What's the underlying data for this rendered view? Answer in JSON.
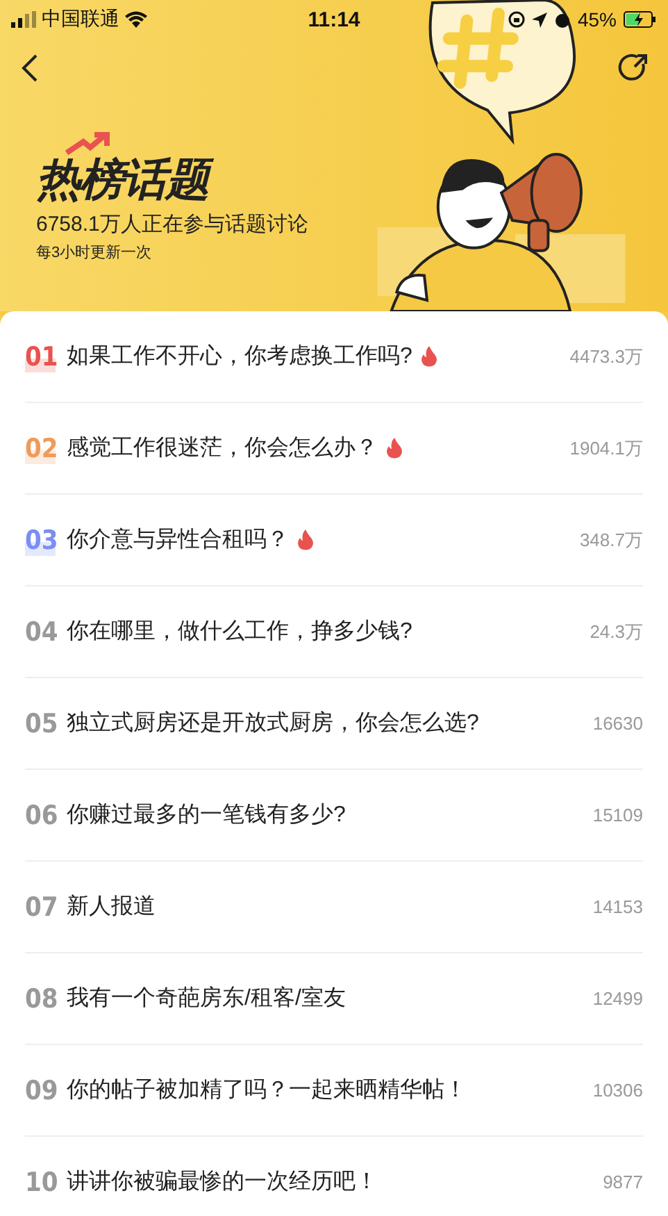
{
  "status_bar": {
    "carrier": "中国联通",
    "time": "11:14",
    "battery": "45%"
  },
  "header": {
    "title": "热榜话题",
    "participants": "6758.1万人正在参与话题讨论",
    "update_note": "每3小时更新一次"
  },
  "topics": [
    {
      "rank": "01",
      "kind": "top",
      "color": "#e8534f",
      "title": "如果工作不开心，你考虑换工作吗?",
      "hot": true,
      "count": "4473.3万"
    },
    {
      "rank": "02",
      "kind": "top",
      "color": "#f09a5a",
      "title": "感觉工作很迷茫，你会怎么办？",
      "hot": true,
      "count": "1904.1万"
    },
    {
      "rank": "03",
      "kind": "top",
      "color": "#7b8ef2",
      "title": "你介意与异性合租吗？",
      "hot": true,
      "count": "348.7万"
    },
    {
      "rank": "04",
      "kind": "normal",
      "color": "#999999",
      "title": "你在哪里，做什么工作，挣多少钱?",
      "hot": false,
      "count": "24.3万"
    },
    {
      "rank": "05",
      "kind": "normal",
      "color": "#999999",
      "title": "独立式厨房还是开放式厨房，你会怎么选?",
      "hot": false,
      "count": "16630"
    },
    {
      "rank": "06",
      "kind": "normal",
      "color": "#999999",
      "title": "你赚过最多的一笔钱有多少?",
      "hot": false,
      "count": "15109"
    },
    {
      "rank": "07",
      "kind": "normal",
      "color": "#999999",
      "title": "新人报道",
      "hot": false,
      "count": "14153"
    },
    {
      "rank": "08",
      "kind": "normal",
      "color": "#999999",
      "title": "我有一个奇葩房东/租客/室友",
      "hot": false,
      "count": "12499"
    },
    {
      "rank": "09",
      "kind": "normal",
      "color": "#999999",
      "title": "你的帖子被加精了吗？一起来晒精华帖！",
      "hot": false,
      "count": "10306"
    },
    {
      "rank": "10",
      "kind": "normal",
      "color": "#999999",
      "title": "讲讲你被骗最惨的一次经历吧！",
      "hot": false,
      "count": "9877"
    }
  ]
}
